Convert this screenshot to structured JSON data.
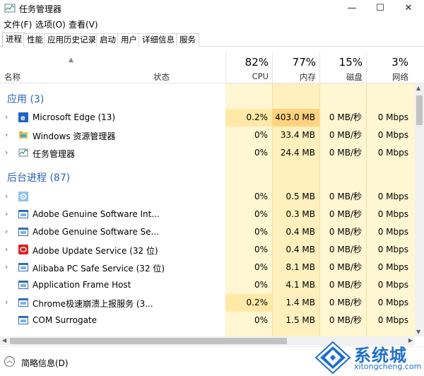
{
  "window": {
    "title": "任务管理器",
    "controls": {
      "minimize": "—",
      "maximize": "☐",
      "close": "✕"
    }
  },
  "menu": [
    "文件(F)",
    "选项(O)",
    "查看(V)"
  ],
  "tabs": [
    "进程",
    "性能",
    "应用历史记录",
    "启动",
    "用户",
    "详细信息",
    "服务"
  ],
  "active_tab": "进程",
  "columns": {
    "name": "名称",
    "status": "状态",
    "cpu": {
      "pct": "82%",
      "label": "CPU"
    },
    "memory": {
      "pct": "77%",
      "label": "内存"
    },
    "disk": {
      "pct": "15%",
      "label": "磁盘"
    },
    "network": {
      "pct": "3%",
      "label": "网络"
    }
  },
  "groups": {
    "apps": "应用 (3)",
    "background": "后台进程 (87)"
  },
  "apps": [
    {
      "name": "Microsoft Edge (13)",
      "icon": "edge-icon",
      "cpu": "0.2%",
      "memory": "403.0 MB",
      "disk": "0 MB/秒",
      "network": "0 Mbps"
    },
    {
      "name": "Windows 资源管理器",
      "icon": "explorer-icon",
      "cpu": "0%",
      "memory": "33.4 MB",
      "disk": "0 MB/秒",
      "network": "0 Mbps"
    },
    {
      "name": "任务管理器",
      "icon": "task-manager-icon",
      "cpu": "0%",
      "memory": "24.4 MB",
      "disk": "0 MB/秒",
      "network": "0 Mbps"
    }
  ],
  "background": [
    {
      "name": "",
      "icon": "gear-icon",
      "cpu": "0%",
      "memory": "0.5 MB",
      "disk": "0 MB/秒",
      "network": "0 Mbps"
    },
    {
      "name": "Adobe Genuine Software Int...",
      "icon": "app-window-icon",
      "cpu": "0%",
      "memory": "0.3 MB",
      "disk": "0 MB/秒",
      "network": "0 Mbps"
    },
    {
      "name": "Adobe Genuine Software Se...",
      "icon": "app-window-icon",
      "cpu": "0%",
      "memory": "0.4 MB",
      "disk": "0 MB/秒",
      "network": "0 Mbps"
    },
    {
      "name": "Adobe Update Service (32 位)",
      "icon": "adobe-icon",
      "cpu": "0%",
      "memory": "0.4 MB",
      "disk": "0 MB/秒",
      "network": "0 Mbps"
    },
    {
      "name": "Alibaba PC Safe Service (32 位)",
      "icon": "app-window-icon",
      "cpu": "0%",
      "memory": "8.1 MB",
      "disk": "0 MB/秒",
      "network": "0 Mbps"
    },
    {
      "name": "Application Frame Host",
      "icon": "app-window-icon",
      "cpu": "0%",
      "memory": "4.1 MB",
      "disk": "0 MB/秒",
      "network": "0 Mbps"
    },
    {
      "name": "Chrome极速崩溃上报服务 (3...",
      "icon": "app-window-icon",
      "cpu": "0.2%",
      "memory": "1.4 MB",
      "disk": "0 MB/秒",
      "network": "0 Mbps"
    },
    {
      "name": "COM Surrogate",
      "icon": "app-window-icon",
      "cpu": "0%",
      "memory": "1.5 MB",
      "disk": "0 MB/秒",
      "network": "0 Mbps"
    }
  ],
  "footer": {
    "label": "简略信息(D)"
  },
  "watermark": {
    "brand": "系统城",
    "url": "xitongcheng.com"
  },
  "colors": {
    "group_heading": "#2b63c0",
    "heat_light": "#fff4c4",
    "heat_mid": "#ffe9a6",
    "heat_strong": "#ffd280",
    "watermark_blue": "#1f70c9"
  }
}
